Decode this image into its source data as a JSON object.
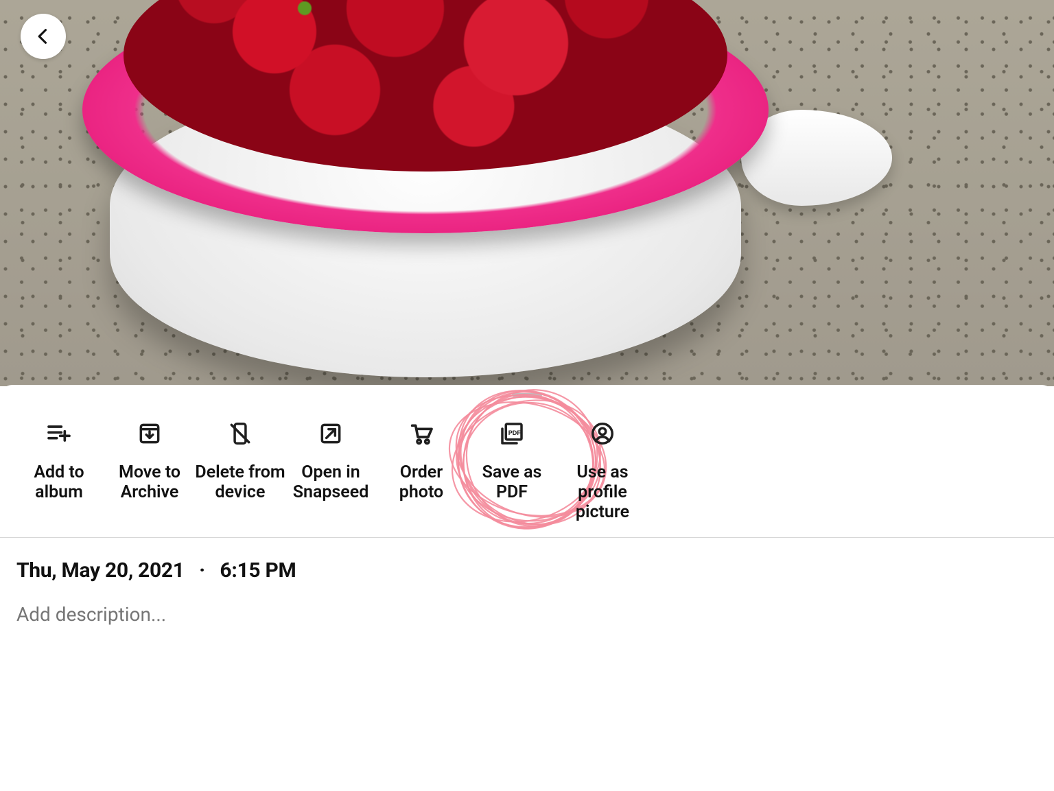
{
  "actions": [
    {
      "label": "Add to album"
    },
    {
      "label": "Move to Archive"
    },
    {
      "label": "Delete from device"
    },
    {
      "label": "Open in Snapseed"
    },
    {
      "label": "Order photo"
    },
    {
      "label": "Save as PDF"
    },
    {
      "label": "Use as profile picture"
    }
  ],
  "meta": {
    "date": "Thu, May 20, 2021",
    "separator": "·",
    "time": "6:15 PM"
  },
  "description": {
    "placeholder": "Add description..."
  }
}
